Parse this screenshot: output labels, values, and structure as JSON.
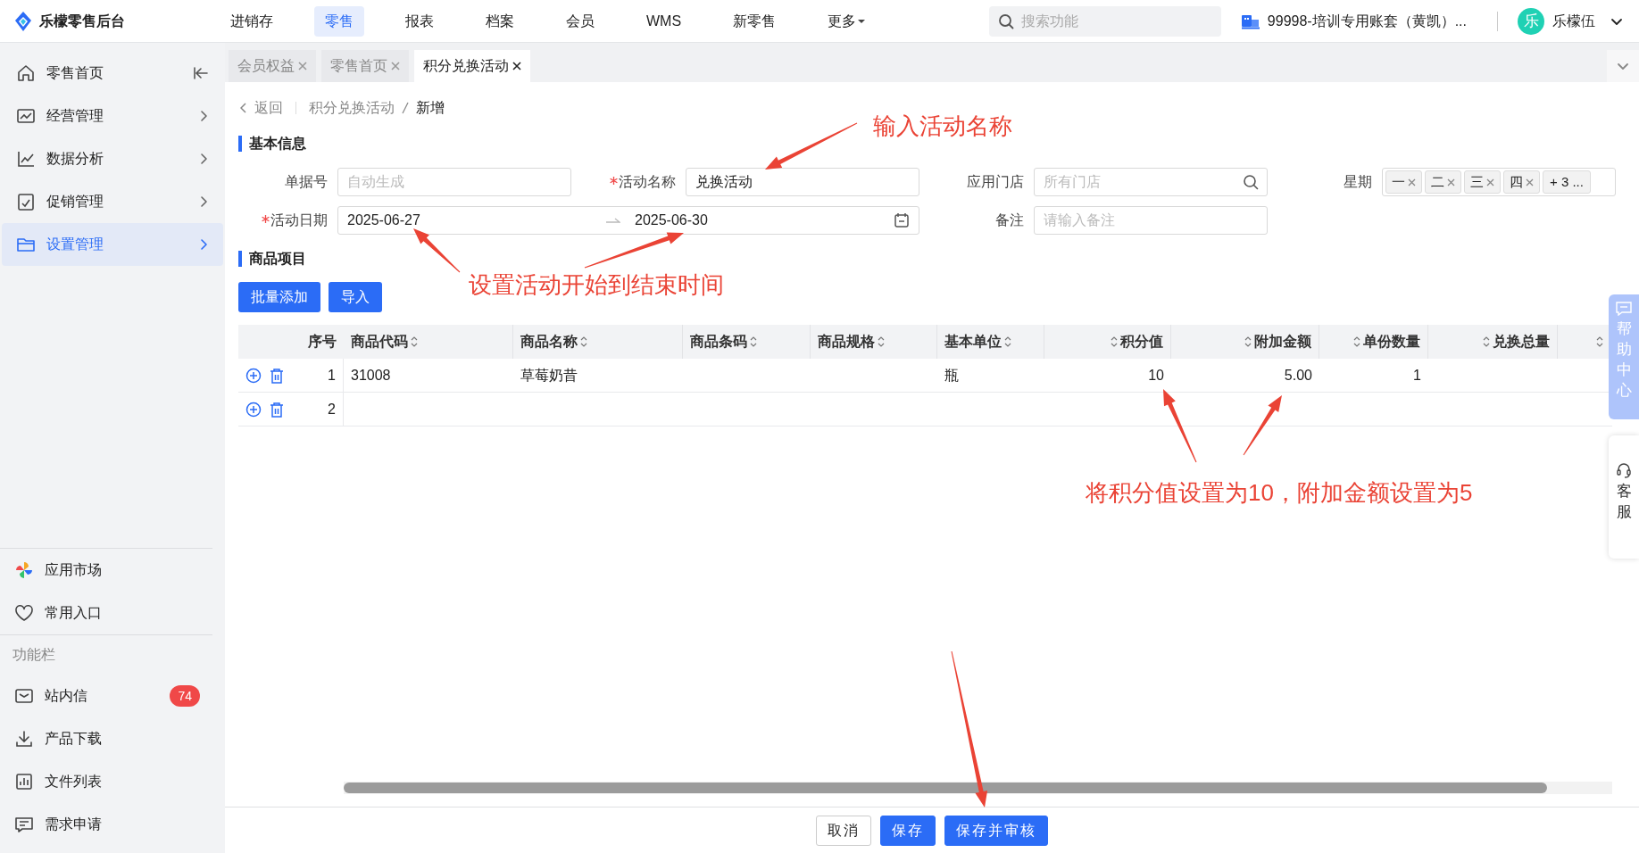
{
  "app": {
    "title": "乐檬零售后台"
  },
  "top_nav": [
    {
      "label": "进销存",
      "selected": false
    },
    {
      "label": "零售",
      "selected": true
    },
    {
      "label": "报表",
      "selected": false
    },
    {
      "label": "档案",
      "selected": false
    },
    {
      "label": "会员",
      "selected": false
    },
    {
      "label": "WMS",
      "selected": false
    },
    {
      "label": "新零售",
      "selected": false
    },
    {
      "label": "更多",
      "selected": false,
      "kind": "dropdown"
    }
  ],
  "search": {
    "placeholder": "搜索功能"
  },
  "account": "99998-培训专用账套（黄凯）...",
  "user": {
    "avatar": "乐",
    "name": "乐檬伍"
  },
  "sidebar": {
    "items": [
      {
        "label": "零售首页",
        "selected": false,
        "has_children": false
      },
      {
        "label": "经营管理",
        "selected": false,
        "has_children": true
      },
      {
        "label": "数据分析",
        "selected": false,
        "has_children": true
      },
      {
        "label": "促销管理",
        "selected": false,
        "has_children": true
      },
      {
        "label": "设置管理",
        "selected": true,
        "has_children": true
      }
    ],
    "shortcuts": [
      "应用市场",
      "常用入口"
    ],
    "function_bar": {
      "title": "功能栏",
      "items": [
        {
          "label": "站内信",
          "badge": "74"
        },
        {
          "label": "产品下载"
        },
        {
          "label": "文件列表"
        },
        {
          "label": "需求申请"
        }
      ]
    }
  },
  "tabs": [
    {
      "label": "会员权益",
      "selected": false
    },
    {
      "label": "零售首页",
      "selected": false
    },
    {
      "label": "积分兑换活动",
      "selected": true
    }
  ],
  "breadcrumb": {
    "back": "返回",
    "path": [
      "积分兑换活动",
      "新增"
    ]
  },
  "basic_info": {
    "title": "基本信息",
    "doc_no": {
      "label": "单据号",
      "required": false,
      "placeholder": "自动生成"
    },
    "activity_name": {
      "label": "活动名称",
      "required": true,
      "value": "兑换活动"
    },
    "store": {
      "label": "应用门店",
      "required": false,
      "placeholder": "所有门店"
    },
    "weekdays": {
      "label": "星期",
      "tags": [
        "一",
        "二",
        "三",
        "四"
      ],
      "more": "+ 3 ..."
    },
    "activity_date": {
      "label": "活动日期",
      "required": true,
      "start": "2025-06-27",
      "end": "2025-06-30"
    },
    "remark": {
      "label": "备注",
      "required": false,
      "placeholder": "请输入备注"
    }
  },
  "goods": {
    "title": "商品项目",
    "buttons": [
      "批量添加",
      "导入"
    ],
    "columns": [
      "序号",
      "商品代码",
      "商品名称",
      "商品条码",
      "商品规格",
      "基本单位",
      "积分值",
      "附加金额",
      "单份数量",
      "兑换总量"
    ],
    "rows": [
      {
        "index": "1",
        "code": "31008",
        "name": "草莓奶昔",
        "unit": "瓶",
        "points": "10",
        "extra_amount": "5.00",
        "qty": "1"
      },
      {
        "index": "2"
      }
    ]
  },
  "footer_buttons": [
    {
      "label": "取消",
      "kind": "default"
    },
    {
      "label": "保存",
      "kind": "primary"
    },
    {
      "label": "保存并审核",
      "kind": "primary"
    }
  ],
  "side_help": {
    "help_center": "帮助中心",
    "service": "客服"
  },
  "annotations": [
    "输入活动名称",
    "设置活动开始到结束时间",
    "将积分值设置为10，附加金额设置为5"
  ]
}
